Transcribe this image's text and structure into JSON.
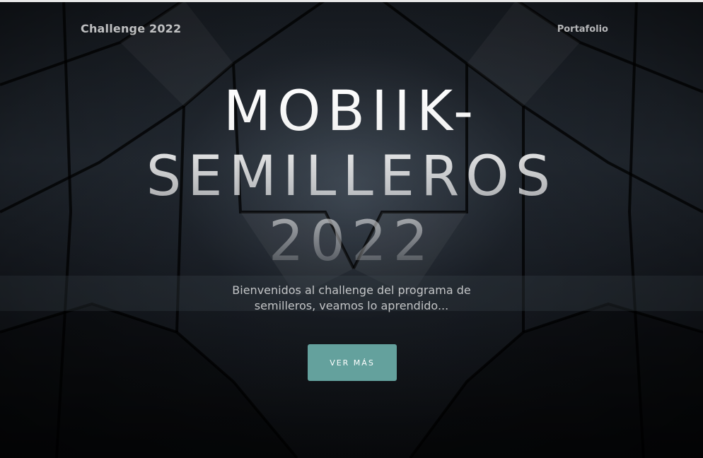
{
  "nav": {
    "brand": "Challenge 2022",
    "link": "Portafolio"
  },
  "hero": {
    "title_line1": "MOBIIK-",
    "title_line2": "SEMILLEROS",
    "title_line3": "2022",
    "subtitle": "Bienvenidos al challenge del programa de semilleros, veamos lo aprendido...",
    "button_label": "VER MÁS"
  },
  "colors": {
    "button": "#64a19d",
    "text": "#ffffff"
  }
}
